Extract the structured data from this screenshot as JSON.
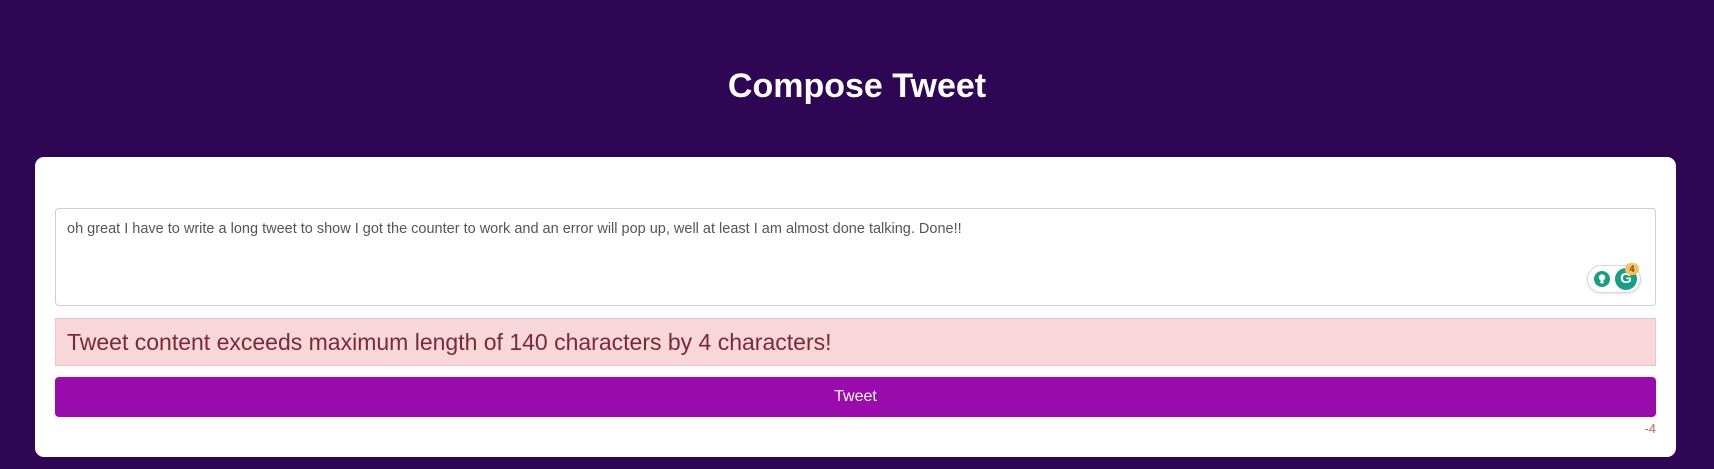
{
  "page": {
    "title": "Compose Tweet"
  },
  "composer": {
    "tweet_text": "oh great I have to write a long tweet to show I got the counter to work and an error will pop up, well at least I am almost done talking. Done!!",
    "error_message": "Tweet content exceeds maximum length of 140 characters by 4 characters!",
    "tweet_button_label": "Tweet",
    "char_counter": "-4"
  },
  "grammarly": {
    "badge_count": "4",
    "logo_letter": "G",
    "bulb_icon": "lightbulb-icon",
    "logo_icon": "grammarly-icon"
  },
  "colors": {
    "background": "#2e0653",
    "button": "#990bac",
    "alert_background": "#f8d7da",
    "alert_text": "#7a2a35",
    "counter_negative": "#e05a5a",
    "grammarly_green": "#15a085"
  }
}
